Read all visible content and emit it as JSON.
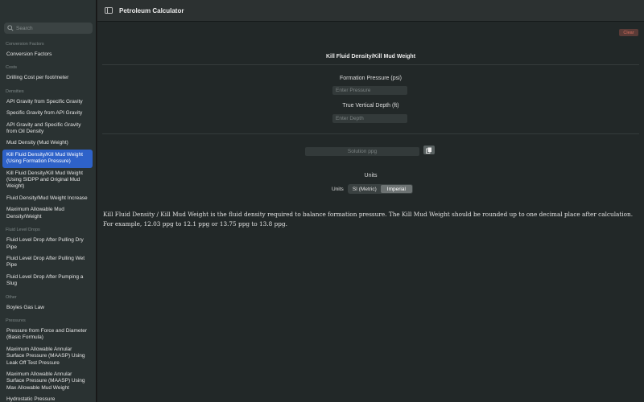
{
  "app": {
    "title": "Petroleum Calculator"
  },
  "search": {
    "placeholder": "Search"
  },
  "sidebar": {
    "sections": [
      {
        "header": "Conversion Factors",
        "items": [
          "Conversion Factors"
        ]
      },
      {
        "header": "Costs",
        "items": [
          "Drilling Cost per foot/meter"
        ]
      },
      {
        "header": "Densities",
        "items": [
          "API Gravity from Specific Gravity",
          "Specific Gravity from API Gravity",
          "API Gravity and Specific Gravity from Oil Density",
          "Mud Density (Mud Weight)",
          "Kill Fluid Density/Kill Mud Weight (Using Formation Pressure)",
          "Kill Fluid Density/Kill Mud Weight (Using SIDPP and Original Mud Weight)",
          "Fluid Density/Mud Weight Increase",
          "Maximum Allowable Mud Density/Weight"
        ]
      },
      {
        "header": "Fluid Level Drops",
        "items": [
          "Fluid Level Drop After Pulling Dry Pipe",
          "Fluid Level Drop After Pulling Wet Pipe",
          "Fluid Level Drop After Pumping a Slug"
        ]
      },
      {
        "header": "Other",
        "items": [
          "Boyles Gas Law"
        ]
      },
      {
        "header": "Pressures",
        "items": [
          "Pressure from Force and Diameter (Basic Formula)",
          "Maximum Allowable Annular Surface Pressure (MAASP) Using Leak Off Test Pressure",
          "Maximum Allowable Annular Surface Pressure (MAASP) Using Max Allowable Mud Weight",
          "Hydrostatic Pressure"
        ]
      }
    ],
    "active_item": "Kill Fluid Density/Kill Mud Weight (Using Formation Pressure)"
  },
  "toolbar": {
    "clear_label": "Clear"
  },
  "calculator": {
    "heading": "Kill Fluid Density/Kill Mud Weight",
    "pressure_label": "Formation Pressure (psi)",
    "pressure_placeholder": "Enter Pressure",
    "depth_label": "True Vertical Depth (ft)",
    "depth_placeholder": "Enter Depth",
    "solution_placeholder": "Solution ppg",
    "units_title": "Units",
    "units_label": "Units",
    "unit_options": [
      "SI (Metric)",
      "Imperial"
    ],
    "selected_unit": "Imperial"
  },
  "description": "Kill Fluid Density / Kill Mud Weight is the fluid density required to balance formation pressure. The Kill Mud Weight should be rounded up to one decimal place after calculation. For example, 12.03 ppg to 12.1 ppg or 13.75 ppg to 13.8 ppg.",
  "colors": {
    "accent": "#2e62c9",
    "clear_text": "#d9705f",
    "clear_bg": "#5a3b37"
  },
  "icons": {
    "search": "search-icon",
    "sidebar_toggle": "sidebar-toggle-icon",
    "copy": "copy-icon"
  }
}
